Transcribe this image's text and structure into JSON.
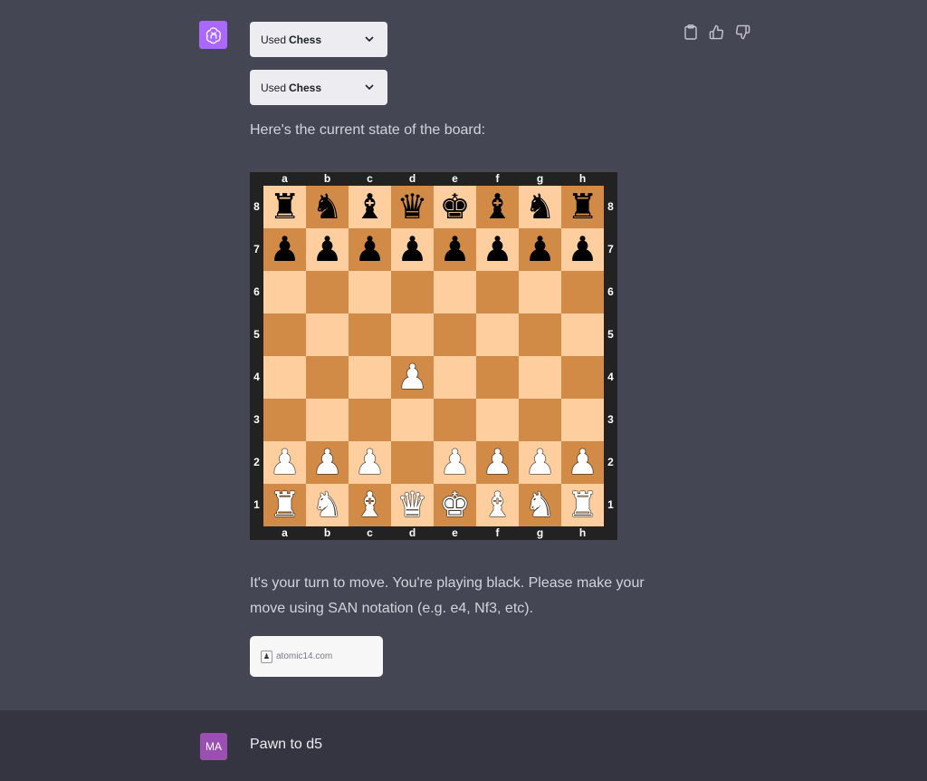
{
  "plugins": [
    {
      "prefix": "Used",
      "name": "Chess"
    },
    {
      "prefix": "Used",
      "name": "Chess"
    }
  ],
  "intro_text": "Here's the current state of the board:",
  "board": {
    "files": [
      "a",
      "b",
      "c",
      "d",
      "e",
      "f",
      "g",
      "h"
    ],
    "ranks": [
      "8",
      "7",
      "6",
      "5",
      "4",
      "3",
      "2",
      "1"
    ],
    "light_color": "#fece9e",
    "dark_color": "#d18b47",
    "position": [
      [
        "br",
        "bn",
        "bb",
        "bq",
        "bk",
        "bb",
        "bn",
        "br"
      ],
      [
        "bp",
        "bp",
        "bp",
        "bp",
        "bp",
        "bp",
        "bp",
        "bp"
      ],
      [
        "",
        "",
        "",
        "",
        "",
        "",
        "",
        ""
      ],
      [
        "",
        "",
        "",
        "",
        "",
        "",
        "",
        ""
      ],
      [
        "",
        "",
        "",
        "wp",
        "",
        "",
        "",
        ""
      ],
      [
        "",
        "",
        "",
        "",
        "",
        "",
        "",
        ""
      ],
      [
        "wp",
        "wp",
        "wp",
        "",
        "wp",
        "wp",
        "wp",
        "wp"
      ],
      [
        "wr",
        "wn",
        "wb",
        "wq",
        "wk",
        "wb",
        "wn",
        "wr"
      ]
    ]
  },
  "turn_text_line1": "It's your turn to move. You're playing black. Please make your",
  "turn_text_line2": "move using SAN notation (e.g. e4, Nf3, etc).",
  "source": {
    "domain": "atomic14.com"
  },
  "user": {
    "initials": "MA",
    "message": "Pawn to d5"
  },
  "colors": {
    "assistant_bg": "#444654",
    "user_bg": "#343541",
    "gpt_avatar": "#ab68ff",
    "user_avatar": "#9b4fb3"
  },
  "icons": [
    "openai-logo-icon",
    "clipboard-icon",
    "thumbs-up-icon",
    "thumbs-down-icon",
    "chevron-down-icon",
    "favicon-icon"
  ]
}
